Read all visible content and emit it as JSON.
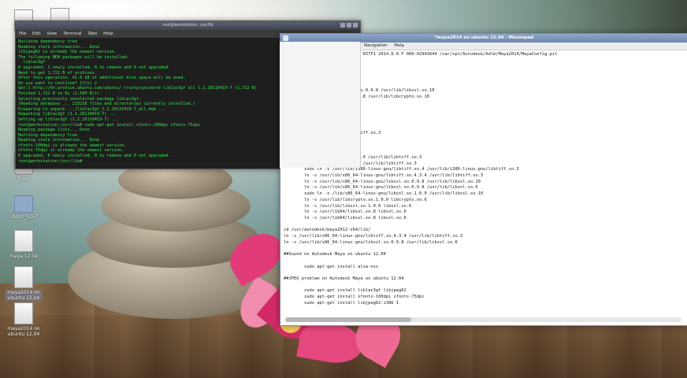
{
  "desktop": {
    "icons": [
      {
        "label": ""
      },
      {
        "label": ""
      },
      {
        "label": "Trash"
      },
      {
        "label": "LINUX_SOFT"
      },
      {
        "label": "maya 12.04"
      },
      {
        "label": "maya2014 on ubuntu 12.04"
      },
      {
        "label": "maya2014 on ubuntu 12.04"
      }
    ]
  },
  "terminal": {
    "title": "root@workstation: /usr/lib",
    "menu": [
      "File",
      "Edit",
      "View",
      "Terminal",
      "Tabs",
      "Help"
    ],
    "lines": [
      "Building dependency tree",
      "Reading state information... Done",
      "libjpeg62 is already the newest version.",
      "The following NEW packages will be installed:",
      "  liblas3gf",
      "0 upgraded, 1 newly installed, 0 to remove and 0 not upgraded.",
      "Need to get 1,722 B of archives.",
      "After this operation, 41.0 kB of additional disk space will be used.",
      "Do you want to continue? [Y/n] y",
      "Get:1 http://kh.archive.ubuntu.com/ubuntu/ trusty/universe liblas3gf all 1.2.20110419-7 (1,722 B)",
      "Fetched 1,722 B in 0s (2,500 B/s)",
      "Selecting previously unselected package liblas3gf.",
      "(Reading database ... 233218 files and directories currently installed.)",
      "Preparing to unpack .../liblas3gf_1.2.20110419-7_all.deb ...",
      "Unpacking liblas3gf (1.2.20110419-7) ...",
      "Setting up liblas3gf (1.2.20110419-7) ...",
      "root@workstation:/usr/lib# sudo apt-get install xfonts-100dpi xfonts-75dpi",
      "Reading package lists... Done",
      "Building dependency tree",
      "Reading state information... Done",
      "xfonts-100dpi is already the newest version.",
      "xfonts-75dpi is already the newest version.",
      "0 upgraded, 0 newly installed, 0 to remove and 0 not upgraded.",
      "root@workstation:/usr/lib# "
    ]
  },
  "mousepad": {
    "title": "*maya2014 on ubuntu 12.04 - Mousepad",
    "menu": [
      "Navigation",
      "Help"
    ],
    "lines": [
      "014-x64/bin/adlmreg -i S 657F1 657F1 2014.0.0.F 000-42943644 /var/opt/Autodesk/Adlm/Maya2014/MayaConfig.pit",
      "",
      "",
      "",
      "",
      "    x64/lib/",
      "    /x86_64-linux-gnu/libssl.so.0.9.8 /usr/lib/libssl.so.10",
      "    linux-gnu/libcrypto.so.0.9.8 /usr/lib/libcrypto.so.10",
      "    libtiff4",
      "    libssl0.9.8",
      "",
      "    libssl1.0.0 libssl-dev",
      "",
      "    libtiff.so.4 /usr/lib/libtiff.so.3",
      "",
      "",
      "",
      "    4-linux-gnu/libtiff.so.4.3.4 /usr/lib/libtiff.so.3",
      "    linux-gnu/libtiff.so.4.3.4 /usr/lib/libtiff.so.3",
      "        sudo ln -s /usr/lib/i386-linux-gnu/libtiff.so.4 /usr/lib/i386-linux-gnu/libtiff.so.3",
      "        ln -s /usr/lib/x86_64-linux-gnu/libtiff.so.4.3.4 /usr/lib/libtiff.so.3",
      "        ln -s /usr/lib/x86_64-linux-gnu/libssl.so.0.9.8 /usr/lib/libssl.so.10",
      "        ln -s /usr/lib/x86_64-linux-gnu/libssl.so.0.9.8 /usr/lib/libssl.so.6",
      "        sudo ln -s /lib/x86_64-linux-gnu/libssl.so.1.0.0 /usr/lib/libssl.so.10",
      "        ln -s /usr/lib/libcrypto.so.1.0.0 libcrypto.so.6",
      "        ln -s /usr/lib/libssl.so.1.0.0 libssl.so.6",
      "        ln -s /usr/lib64/libssl.so.8 libssl.so.6",
      "        ln -s /usr/lib64/libssl.so.8 libssl.so.6",
      "",
      "cd /usr/autodesk/maya2012-x64/lib/",
      "ln -s /usr/lib/x86_64-linux-gnu/libtiff.so.4.3.4 /usr/lib/libtiff.so.3",
      "ln -s /usr/lib/x86_64-linux-gnu/libssl.so.0.9.8 /usr/lib/libssl.so.6",
      "",
      "##Sound on Autodesk Maya on ubuntu 12.04",
      "",
      "        sudo apt-get install alsa-oss",
      "",
      "##JPEG problem on Autodesk Maya on ubuntu 12.04",
      "",
      "        sudo apt-get install liblas3gf libjpeg62",
      "        sudo apt-get install xfonts-100dpi xfonts-75dpi",
      "        sudo apt-get install libjpeg62:i386 I"
    ]
  }
}
